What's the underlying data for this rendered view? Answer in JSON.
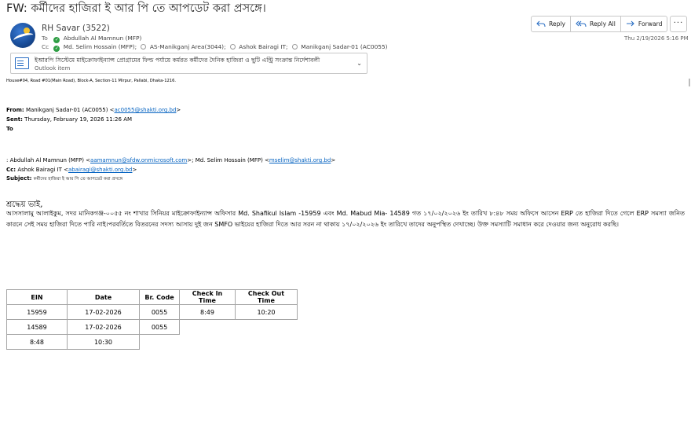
{
  "email": {
    "subject": "FW: কর্মীদের হাজিরা ই আর পি তে আপডেট করা প্রসঙ্গে।",
    "sender": "RH Savar (3522)",
    "to_label": "To",
    "to": [
      "Abdullah Al Mamnun (MFP)"
    ],
    "cc_label": "Cc",
    "cc": [
      "Md. Selim Hossain (MFP);",
      "AS-Manikganj Area(3044);",
      "Ashok Bairagi IT;",
      "Manikganj Sadar-01 (AC0055)"
    ],
    "date": "Thu 2/19/2026 5:16 PM"
  },
  "actions": {
    "reply": "Reply",
    "reply_all": "Reply All",
    "forward": "Forward",
    "more": "···"
  },
  "attachment": {
    "title": "ইআরপি সিস্টেমে মাইক্রোফাইন্যান্স প্রোগ্রামের ফিল্ড পর্যায়ে কর্মরত কর্মীদের দৈনিক হাজিরা ও ছুটি এন্ট্রি সংক্রান্ত নির্দেশাবলী",
    "subtitle": "Outlook item"
  },
  "body": {
    "address": "House#04, Road #01(Main Road), Block-A, Section-11 Mirpur, Pallabi, Dhaka-1216.",
    "from_label": "From:",
    "from_name": "Manikganj Sadar-01 (AC0055) <",
    "from_email": "ac0055@shakti.org.bd",
    "from_end": ">",
    "sent_label": "Sent:",
    "sent_value": "Thursday, February 19, 2026 11:26 AM",
    "to_label": "To",
    "to_line_prefix": ": Abdullah Al Mamnun (MFP) <",
    "to_email1": "aamamnun@sfdw.onmicrosoft.com",
    "to_line_mid": ">; Md. Selim Hossain (MFP) <",
    "to_email2": "mselim@shakti.org.bd",
    "to_line_end": ">",
    "cc_label": "Cc:",
    "cc_name": "Ashok Bairagi IT <",
    "cc_email": "abairagi@shakti.org.bd",
    "cc_end": ">",
    "subject_label": "Subject:",
    "subject_value": "কর্মীদের হাজিরা ই আর পি তে আপডেট করা প্রসঙ্গে",
    "greeting": "শ্রদ্ধেয় ভাই,",
    "paragraph": "আসসালামু আলাইকুম, সদর মানিকগঞ্জ-০০৫৫ নং শাখার সিনিয়র মাইক্রোফাইন্যান্স অফিসার Md. Shafikul Islam -15959 এবং Md. Mabud Mia- 14589 গত ১৭/০২/২০২৬ ইং তারিখ ৮:৪৮ সময় অফিসে আসেন ERP তে হাজিরা দিতে গেলে ERP সমস্যা জনিত কারনে সেই সময় হাজিরা দিতে পারি নাই।পরবর্তিতে বিতরনের সদস্য আসায় দুই জন SMFO ভাইয়ের হাজিরা দিতে আর সরন না থাকায় ১৭/০২/২০২৬ ইং তারিখে তাদের অনুপস্থিত দেখাচ্ছে। উক্ত সমস্যাটি সমাধান করে দেওয়ার জন্য অনুরোধ করছি।"
  },
  "table": {
    "headers": [
      "EIN",
      "Date",
      "Br. Code",
      "Check In Time",
      "Check Out Time"
    ],
    "rows": [
      [
        "15959",
        "17-02-2026",
        "0055",
        "8:49",
        "10:20"
      ],
      [
        "14589",
        "17-02-2026",
        "0055"
      ],
      [
        "8:48",
        "10:30"
      ]
    ]
  }
}
